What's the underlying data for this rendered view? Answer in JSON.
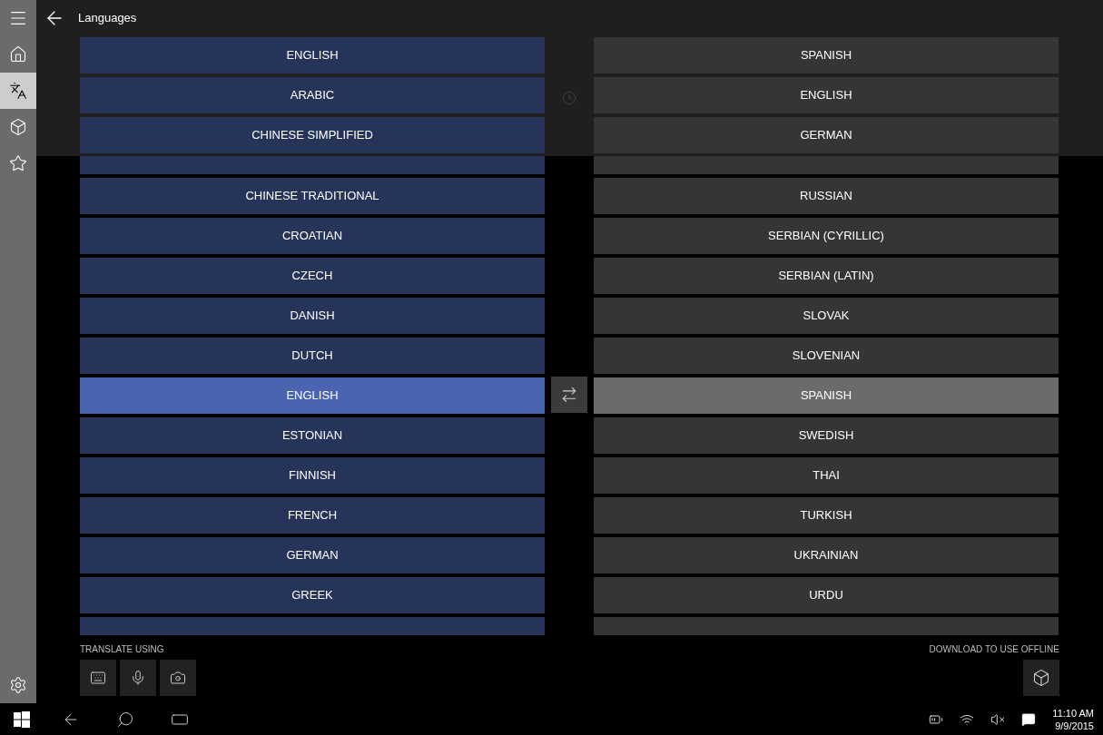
{
  "header": {
    "title": "Languages"
  },
  "sidebar": {
    "items": [
      {
        "kind": "home",
        "selected": false
      },
      {
        "kind": "translate",
        "selected": true
      },
      {
        "kind": "offline",
        "selected": false
      },
      {
        "kind": "favorites",
        "selected": false
      }
    ]
  },
  "recent": {
    "from": [
      "ENGLISH",
      "ARABIC",
      "CHINESE SIMPLIFIED"
    ],
    "to": [
      "SPANISH",
      "ENGLISH",
      "GERMAN"
    ]
  },
  "from_languages": [
    {
      "label": "CHINESE TRADITIONAL",
      "selected": false
    },
    {
      "label": "CROATIAN",
      "selected": false
    },
    {
      "label": "CZECH",
      "selected": false
    },
    {
      "label": "DANISH",
      "selected": false
    },
    {
      "label": "DUTCH",
      "selected": false
    },
    {
      "label": "ENGLISH",
      "selected": true
    },
    {
      "label": "ESTONIAN",
      "selected": false
    },
    {
      "label": "FINNISH",
      "selected": false
    },
    {
      "label": "FRENCH",
      "selected": false
    },
    {
      "label": "GERMAN",
      "selected": false
    },
    {
      "label": "GREEK",
      "selected": false
    }
  ],
  "to_languages": [
    {
      "label": "RUSSIAN",
      "selected": false
    },
    {
      "label": "SERBIAN (CYRILLIC)",
      "selected": false
    },
    {
      "label": "SERBIAN (LATIN)",
      "selected": false
    },
    {
      "label": "SLOVAK",
      "selected": false
    },
    {
      "label": "SLOVENIAN",
      "selected": false
    },
    {
      "label": "SPANISH",
      "selected": true
    },
    {
      "label": "SWEDISH",
      "selected": false
    },
    {
      "label": "THAI",
      "selected": false
    },
    {
      "label": "TURKISH",
      "selected": false
    },
    {
      "label": "UKRAINIAN",
      "selected": false
    },
    {
      "label": "URDU",
      "selected": false
    }
  ],
  "translate_using": {
    "label": "TRANSLATE USING"
  },
  "offline": {
    "label": "DOWNLOAD TO USE OFFLINE"
  },
  "taskbar": {
    "time": "11:10 AM",
    "date": "9/9/2015"
  }
}
